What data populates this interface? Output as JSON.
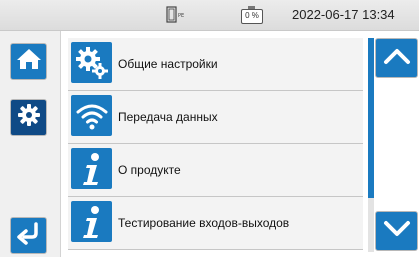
{
  "status": {
    "battery_percent": "0 %",
    "datetime": "2022-06-17  13:34"
  },
  "nav": {
    "home_icon": "home-icon",
    "settings_icon": "gear-icon",
    "back_icon": "return-arrow-icon"
  },
  "menu": {
    "items": [
      {
        "label": "Общие настройки",
        "icon": "gears-icon"
      },
      {
        "label": "Передача данных",
        "icon": "wifi-icon"
      },
      {
        "label": "О продукте",
        "icon": "info-icon"
      },
      {
        "label": "Тестирование входов-выходов",
        "icon": "info-icon"
      }
    ]
  },
  "scroll": {
    "up_icon": "chevron-up-icon",
    "down_icon": "chevron-down-icon"
  },
  "colors": {
    "accent": "#1a7ac0",
    "accent_selected": "#0f4a86",
    "statusbar": "#e4e4e4"
  }
}
